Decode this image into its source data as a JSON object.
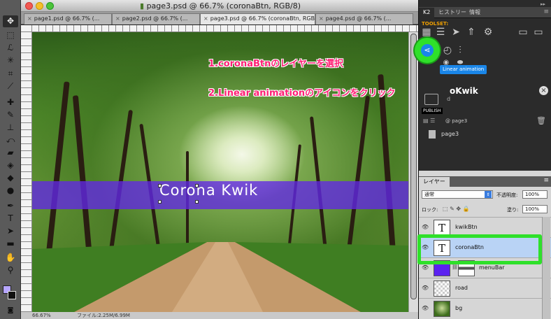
{
  "window": {
    "title": "page3.psd @ 66.7% (coronaBtn, RGB/8)"
  },
  "tabs": [
    {
      "label": "page1.psd @ 66.7% (..."
    },
    {
      "label": "page2.psd @ 66.7% (..."
    },
    {
      "label": "page3.psd @ 66.7% (coronaBtn, RGB/8)"
    },
    {
      "label": "page4.psd @ 66.7% (..."
    }
  ],
  "canvas": {
    "menu_text": "Corona Kwik",
    "annotation_1": "1.coronaBtnのレイヤーを選択",
    "annotation_2": "2.Linear animationのアイコンをクリック"
  },
  "status": {
    "zoom": "66.67%",
    "doc_info": "ファイル:2.25M/6.99M"
  },
  "k2": {
    "tabs": [
      "K2",
      "ヒストリー",
      "情報"
    ],
    "toolset_label": "TOOLSET:",
    "tooltip": "Linear animation",
    "project_title": "oKwik",
    "publish_label": "PUBLISH",
    "page_ref": "@ page3",
    "page_name": "page3",
    "id_text": "d"
  },
  "layers": {
    "tab_label": "レイヤー",
    "blend_mode": "通常",
    "opacity_label": "不透明度:",
    "opacity_value": "100%",
    "lock_label": "ロック:",
    "fill_label": "塗り:",
    "fill_value": "100%",
    "items": [
      {
        "name": "kwikBtn",
        "type": "text"
      },
      {
        "name": "coronaBtn",
        "type": "text"
      },
      {
        "name": "menuBar",
        "type": "shape"
      },
      {
        "name": "road",
        "type": "image"
      },
      {
        "name": "bg",
        "type": "image"
      }
    ]
  },
  "colors": {
    "accent_green": "#2fe02a",
    "annotation_pink": "#ff1f74",
    "menubar_purple": "#6228e6",
    "tooltip_blue": "#1a86e8",
    "toolset_orange": "#f0a000"
  }
}
